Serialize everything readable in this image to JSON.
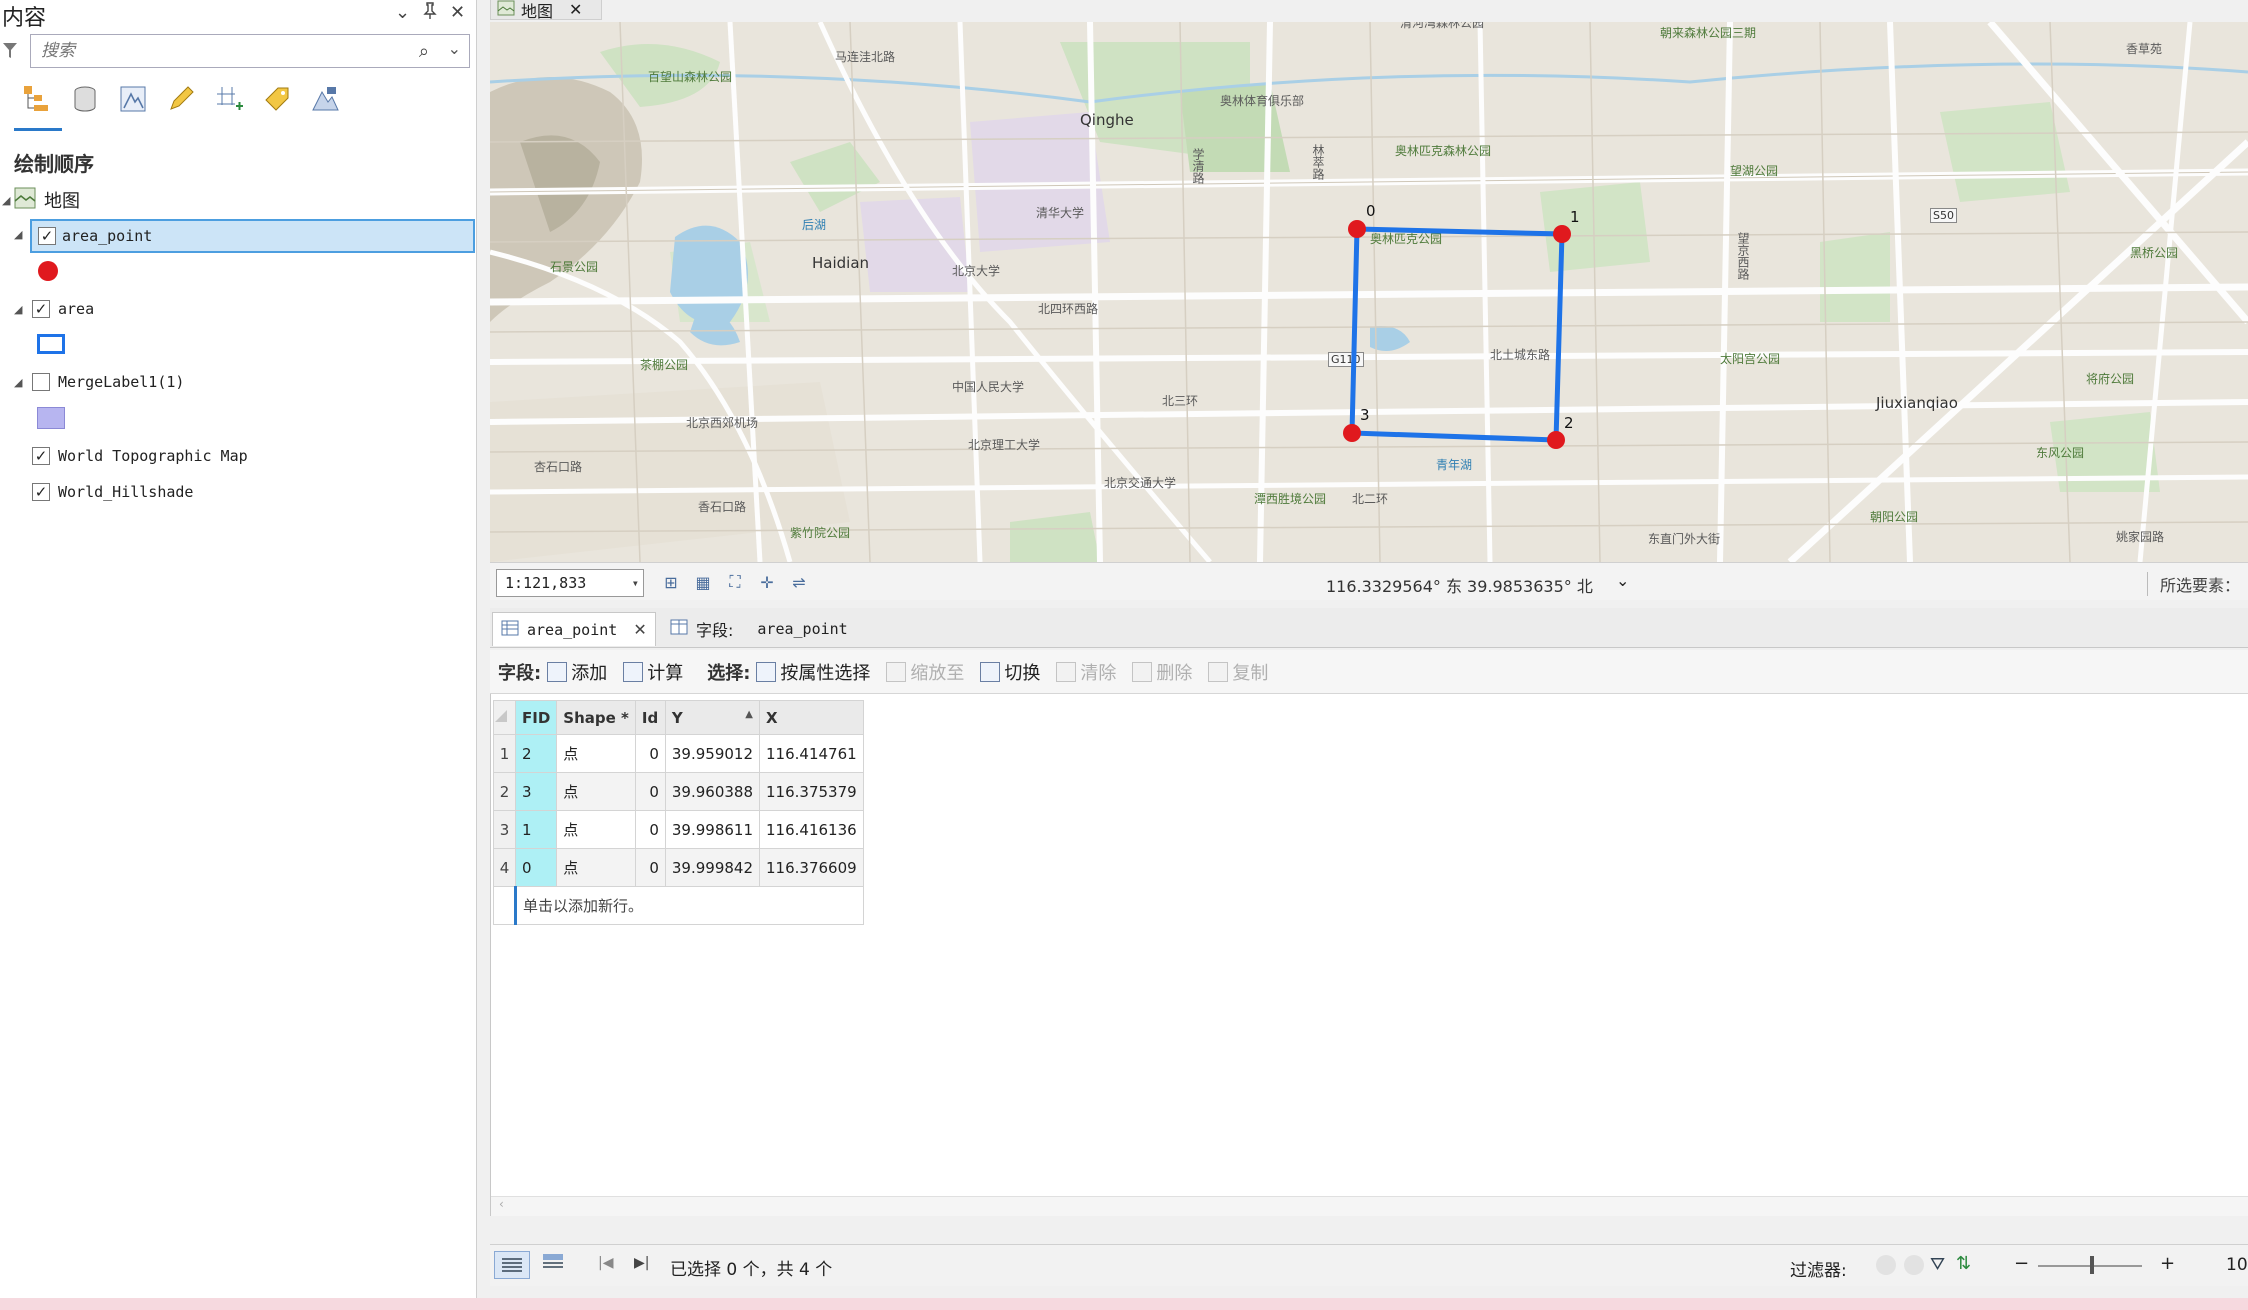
{
  "contents_pane": {
    "title": "内容",
    "search_placeholder": "搜索",
    "section_title": "绘制顺序",
    "map_node": "地图",
    "layers": [
      {
        "name": "area_point",
        "checked": true,
        "symbol": "red-point"
      },
      {
        "name": "area",
        "checked": true,
        "symbol": "blue-outline-rectangle"
      },
      {
        "name": "MergeLabel1(1)",
        "checked": false,
        "symbol": "lavender-fill"
      },
      {
        "name": "World Topographic Map",
        "checked": true
      },
      {
        "name": "World_Hillshade",
        "checked": true
      }
    ],
    "toolbar_icons": [
      "list-by-drawing-order-icon",
      "list-by-data-source-icon",
      "list-by-selection-icon",
      "list-by-editing-icon",
      "list-by-snapping-icon",
      "list-by-labeling-icon",
      "list-by-perspective-imagery-icon"
    ]
  },
  "map_view": {
    "tab_label": "地图",
    "place_labels": [
      {
        "text": "清河湾森林公园"
      },
      {
        "text": "朝来森林公园三期"
      },
      {
        "text": "香草苑"
      },
      {
        "text": "马连洼北路"
      },
      {
        "text": "百望山森林公园"
      },
      {
        "text": "奥林体育俱乐部"
      },
      {
        "text": "Qinghe"
      },
      {
        "text": "奥林匹克森林公园"
      },
      {
        "text": "林萃路"
      },
      {
        "text": "学清路"
      },
      {
        "text": "望湖公园"
      },
      {
        "text": "清华大学"
      },
      {
        "text": "后湖"
      },
      {
        "text": "Haidian"
      },
      {
        "text": "奥林匹克公园"
      },
      {
        "text": "石景公园"
      },
      {
        "text": "北京大学"
      },
      {
        "text": "北四环西路"
      },
      {
        "text": "S50"
      },
      {
        "text": "黑桥公园"
      },
      {
        "text": "望京西路"
      },
      {
        "text": "北土城东路"
      },
      {
        "text": "太阳宫公园"
      },
      {
        "text": "G110"
      },
      {
        "text": "茶棚公园"
      },
      {
        "text": "中国人民大学"
      },
      {
        "text": "北三环"
      },
      {
        "text": "Jiuxianqiao"
      },
      {
        "text": "将府公园"
      },
      {
        "text": "北京西郊机场"
      },
      {
        "text": "北京理工大学"
      },
      {
        "text": "青年湖"
      },
      {
        "text": "东风公园"
      },
      {
        "text": "杏石口路"
      },
      {
        "text": "北京交通大学"
      },
      {
        "text": "北二环"
      },
      {
        "text": "香石口路"
      },
      {
        "text": "潭西胜境公园"
      },
      {
        "text": "朝阳公园"
      },
      {
        "text": "紫竹院公园"
      },
      {
        "text": "东直门外大街"
      },
      {
        "text": "姚家园路"
      }
    ],
    "polygon_points": [
      {
        "label": "0"
      },
      {
        "label": "1"
      },
      {
        "label": "2"
      },
      {
        "label": "3"
      }
    ],
    "colors": {
      "polygon_edge": "#1e73e8",
      "point_fill": "#e0191e"
    },
    "scale": "1:121,833",
    "coordinates": "116.3329564° 东  39.9853635° 北",
    "selected_features_label": "所选要素："
  },
  "attribute_table": {
    "tab_label": "area_point",
    "fields_tab_prefix": "字段:",
    "fields_tab_layer": "area_point",
    "toolbar": {
      "fields_label": "字段:",
      "add": "添加",
      "calculate": "计算",
      "selection_label": "选择:",
      "select_by_attributes": "按属性选择",
      "zoom_to": "缩放至",
      "switch": "切换",
      "clear": "清除",
      "delete": "删除",
      "copy": "复制"
    },
    "columns": [
      "FID",
      "Shape *",
      "Id",
      "Y",
      "X"
    ],
    "sorted_column": "Y",
    "rows": [
      {
        "rownum": "1",
        "FID": "2",
        "Shape": "点",
        "Id": "0",
        "Y": "39.959012",
        "X": "116.414761"
      },
      {
        "rownum": "2",
        "FID": "3",
        "Shape": "点",
        "Id": "0",
        "Y": "39.960388",
        "X": "116.375379"
      },
      {
        "rownum": "3",
        "FID": "1",
        "Shape": "点",
        "Id": "0",
        "Y": "39.998611",
        "X": "116.416136"
      },
      {
        "rownum": "4",
        "FID": "0",
        "Shape": "点",
        "Id": "0",
        "Y": "39.999842",
        "X": "116.376609"
      }
    ],
    "new_row_hint": "单击以添加新行。",
    "status_text": "已选择 0 个，共 4 个",
    "filter_label": "过滤器:",
    "zoom_value": "10"
  }
}
